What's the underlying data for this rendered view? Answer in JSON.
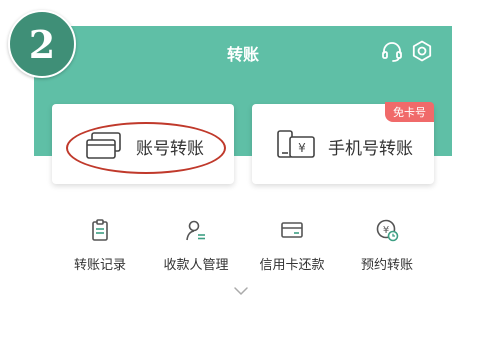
{
  "step_number": "2",
  "header": {
    "title": "转账"
  },
  "cards": [
    {
      "label": "账号转账"
    },
    {
      "label": "手机号转账",
      "tag": "免卡号"
    }
  ],
  "tools": [
    {
      "label": "转账记录",
      "icon": "clipboard-icon"
    },
    {
      "label": "收款人管理",
      "icon": "user-transfer-icon"
    },
    {
      "label": "信用卡还款",
      "icon": "credit-card-icon"
    },
    {
      "label": "预约转账",
      "icon": "yen-clock-icon"
    }
  ],
  "colors": {
    "header_bg": "#5fbfa6",
    "accent": "#3e9f84",
    "annotation": "#c0392b",
    "tag_bg": "#f06a6a"
  }
}
